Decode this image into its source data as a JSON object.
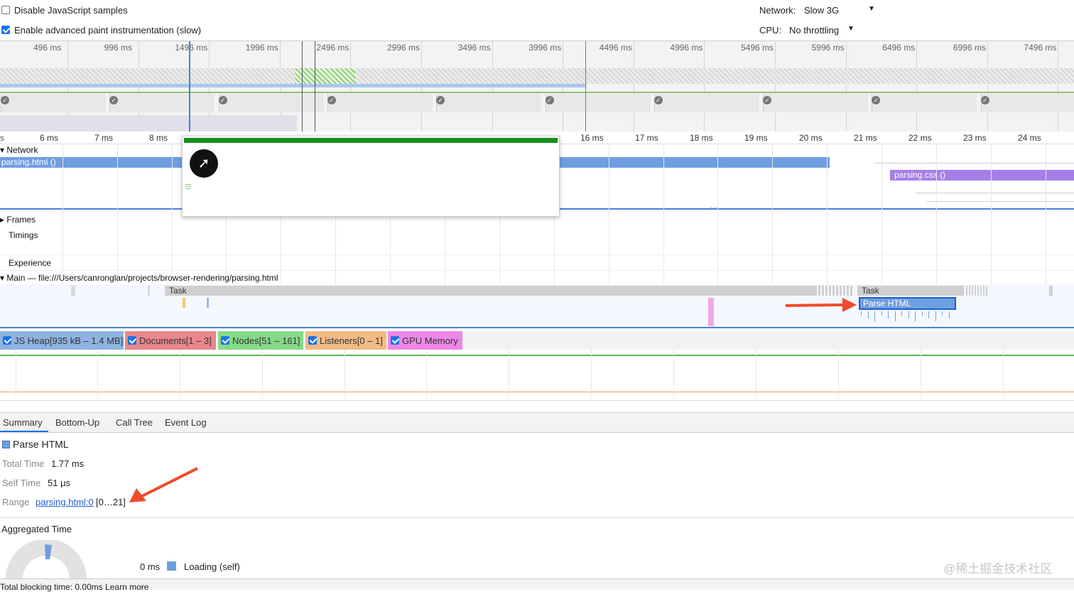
{
  "controls": {
    "disable_js": {
      "label": "Disable JavaScript samples",
      "checked": false
    },
    "advanced_paint": {
      "label": "Enable advanced paint instrumentation (slow)",
      "checked": true
    },
    "network_label": "Network:",
    "network_value": "Slow 3G",
    "cpu_label": "CPU:",
    "cpu_value": "No throttling"
  },
  "overview_ticks": [
    "496 ms",
    "996 ms",
    "1496 ms",
    "1996 ms",
    "2496 ms",
    "2996 ms",
    "3496 ms",
    "3996 ms",
    "4496 ms",
    "4996 ms",
    "5496 ms",
    "5996 ms",
    "6496 ms",
    "6996 ms",
    "7496 ms"
  ],
  "detail_ticks": [
    "6 ms",
    "7 ms",
    "8 ms",
    "16 ms",
    "17 ms",
    "18 ms",
    "19 ms",
    "20 ms",
    "21 ms",
    "22 ms",
    "23 ms",
    "24 ms"
  ],
  "tracks": {
    "network": "Network",
    "network_req1": "parsing.html ()",
    "network_req2": "parsing.css ()",
    "frames": "Frames",
    "timings": "Timings",
    "experience": "Experience",
    "main": "Main — file:///Users/canronglan/projects/browser-rendering/parsing.html",
    "task1": "Task",
    "task2": "Task",
    "parse_html": "Parse HTML"
  },
  "memory": [
    {
      "label": "JS Heap[935 kB – 1.4 MB]",
      "color": "#8fb3e0"
    },
    {
      "label": "Documents[1 – 3]",
      "color": "#e9878b"
    },
    {
      "label": "Nodes[51 – 161]",
      "color": "#86d98a"
    },
    {
      "label": "Listeners[0 – 1]",
      "color": "#f0bb84"
    },
    {
      "label": "GPU Memory",
      "color": "#ee87e8"
    }
  ],
  "tabs": [
    "Summary",
    "Bottom-Up",
    "Call Tree",
    "Event Log"
  ],
  "summary": {
    "title": "Parse HTML",
    "total_time_label": "Total Time",
    "total_time": "1.77 ms",
    "self_time_label": "Self Time",
    "self_time": "51 µs",
    "range_label": "Range",
    "range_link": "parsing.html:0",
    "range_suffix": "[0…21]",
    "aggregated": "Aggregated Time",
    "legend_value": "0 ms",
    "legend_label": "Loading (self)",
    "footer": "Total blocking time: 0.00ms  Learn more"
  },
  "watermark": "@稀土掘金技术社区",
  "colors": {
    "accent": "#1a73e8",
    "network_bar": "#6f9fe0",
    "css_bar": "#a57fe8",
    "task": "#cfcfcf",
    "arrow": "#f04a2b"
  }
}
